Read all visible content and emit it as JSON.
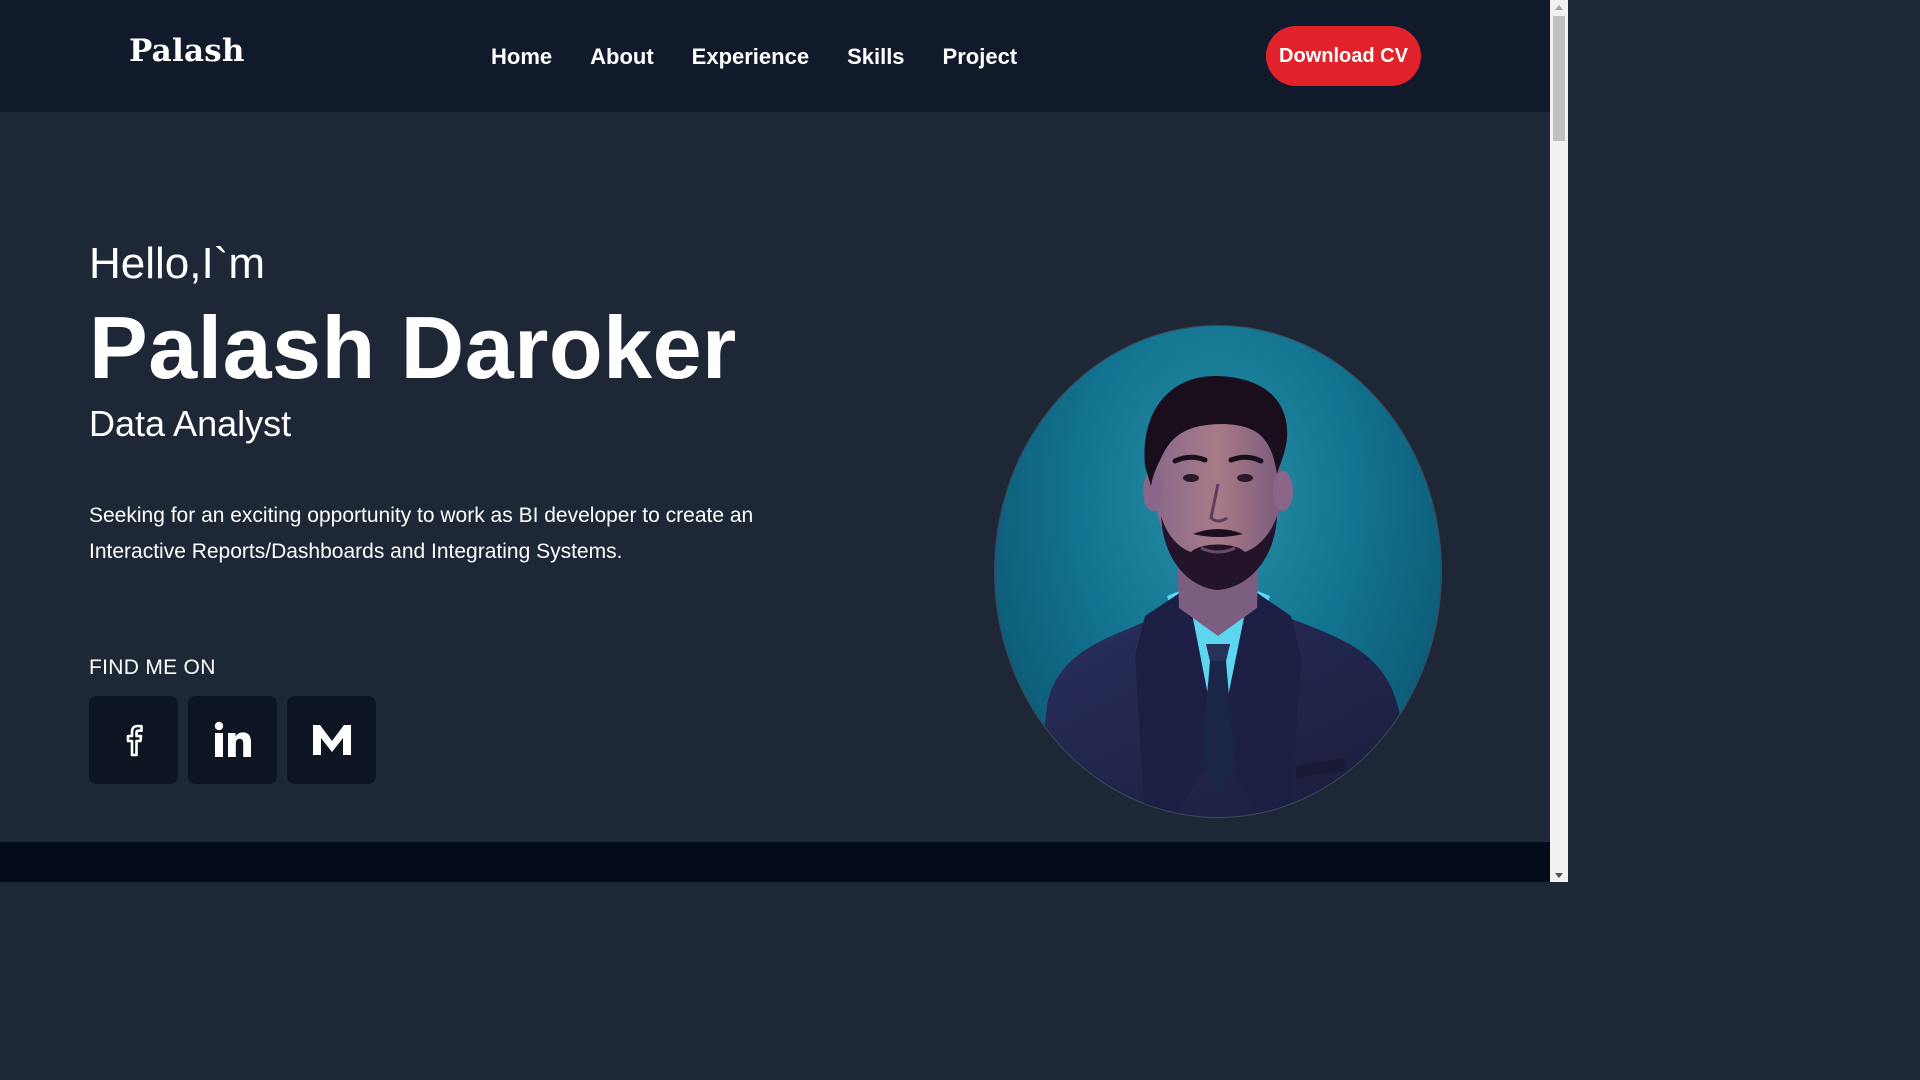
{
  "navbar": {
    "logo": "Palash",
    "links": [
      "Home",
      "About",
      "Experience",
      "Skills",
      "Project"
    ],
    "cta_label": "Download CV"
  },
  "hero": {
    "greeting": "Hello,I`m",
    "name": "Palash Daroker",
    "role": "Data Analyst",
    "summary": "Seeking for an exciting opportunity to work as BI developer to create an Interactive Reports/Dashboards and Integrating Systems.",
    "find_me_label": "FIND ME ON",
    "socials": [
      "facebook-icon",
      "linkedin-icon",
      "medium-icon"
    ]
  },
  "colors": {
    "navbar_bg": "#111a2b",
    "page_bg": "#1e2735",
    "accent": "#e1222a",
    "social_bg": "#0e1522"
  }
}
